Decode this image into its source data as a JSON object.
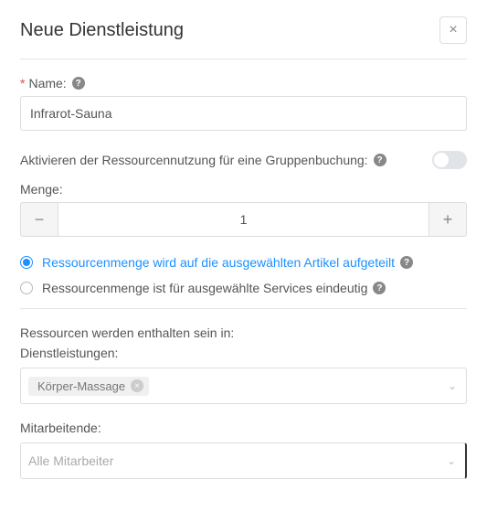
{
  "header": {
    "title": "Neue Dienstleistung"
  },
  "name": {
    "label": "Name:",
    "value": "Infrarot-Sauna"
  },
  "groupBooking": {
    "label": "Aktivieren der Ressourcennutzung für eine Gruppenbuchung:"
  },
  "quantity": {
    "label": "Menge:",
    "value": "1"
  },
  "allocation": {
    "opt1": "Ressourcenmenge wird auf die ausgewählten Artikel aufgeteilt",
    "opt2": "Ressourcenmenge ist für ausgewählte Services eindeutig"
  },
  "containedIn": {
    "label": "Ressourcen werden enthalten sein in:"
  },
  "services": {
    "label": "Dienstleistungen:",
    "tag": "Körper-Massage"
  },
  "employees": {
    "label": "Mitarbeitende:",
    "placeholder": "Alle Mitarbeiter"
  }
}
